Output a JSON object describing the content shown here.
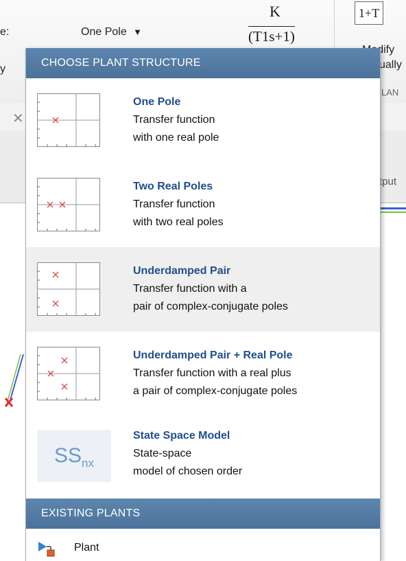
{
  "toolstrip": {
    "left_label_1": "e:",
    "left_label_2": "y",
    "structure_value": "One Pole",
    "formula_numerator": "K",
    "formula_denominator": "(T1s+1)",
    "modify_icon_text": "1+T",
    "modify_label_1": "Modify",
    "modify_label_2": "ually",
    "lan_fragment": "LAN",
    "output_fragment": "tput"
  },
  "dropdown": {
    "choose_header": "CHOOSE PLANT STRUCTURE",
    "items": [
      {
        "title": "One Pole",
        "line1": "Transfer function",
        "line2": "with one real pole",
        "icon": "one-pole-plot-icon"
      },
      {
        "title": "Two Real Poles",
        "line1": "Transfer function",
        "line2": "with two real poles",
        "icon": "two-real-poles-plot-icon"
      },
      {
        "title": "Underdamped Pair",
        "line1": "Transfer function with a",
        "line2": "pair of complex-conjugate poles",
        "icon": "underdamped-pair-plot-icon",
        "selected": true
      },
      {
        "title": "Underdamped Pair + Real Pole",
        "line1": "Transfer function with a real plus",
        "line2": "a pair of complex-conjugate poles",
        "icon": "underdamped-pair-real-pole-plot-icon"
      },
      {
        "title": "State Space Model",
        "line1": "State-space",
        "line2": "model of chosen order",
        "icon": "state-space-icon",
        "icon_text": "SS",
        "icon_sub": "nx"
      }
    ],
    "existing_header": "EXISTING PLANTS",
    "existing_items": [
      {
        "label": "Plant",
        "icon": "plant-block-icon"
      }
    ]
  },
  "colors": {
    "header_bg": "#5277a0",
    "title_text": "#1f4e8c",
    "pole_marker": "#d9534f",
    "selected_bg": "#efefef"
  }
}
